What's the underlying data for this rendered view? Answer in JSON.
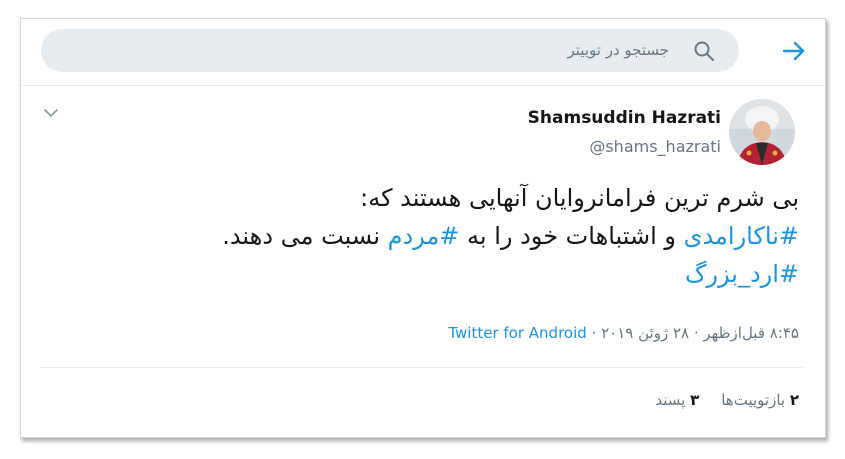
{
  "search": {
    "placeholder": "جستجو در توییتر"
  },
  "tweet": {
    "author_name": "Shamsuddin Hazrati",
    "author_handle": "@shams_hazrati",
    "line1": "بی شرم ترین فرامانروایان آنهایی هستند که:",
    "hashtag1": "#ناکارامدی",
    "line2_mid": " و اشتباهات خود را به ",
    "hashtag2": "#مردم",
    "line2_end": " نسبت می دهند.",
    "hashtag3": "#ارد_بزرگ",
    "timestamp": "۸:۴۵ قبل‌ازظهر · ۲۸ ژوئن ۲۰۱۹",
    "separator": " · ",
    "source": "Twitter for Android",
    "retweets_count": "۲",
    "retweets_label": "بازتوییت‌ها",
    "likes_count": "۳",
    "likes_label": "پسند"
  },
  "colors": {
    "accent": "#1b95e0",
    "muted": "#657786",
    "search_bg": "#e6ecf0"
  },
  "icons": [
    "back-arrow-icon",
    "search-icon",
    "chevron-down-icon",
    "avatar"
  ]
}
